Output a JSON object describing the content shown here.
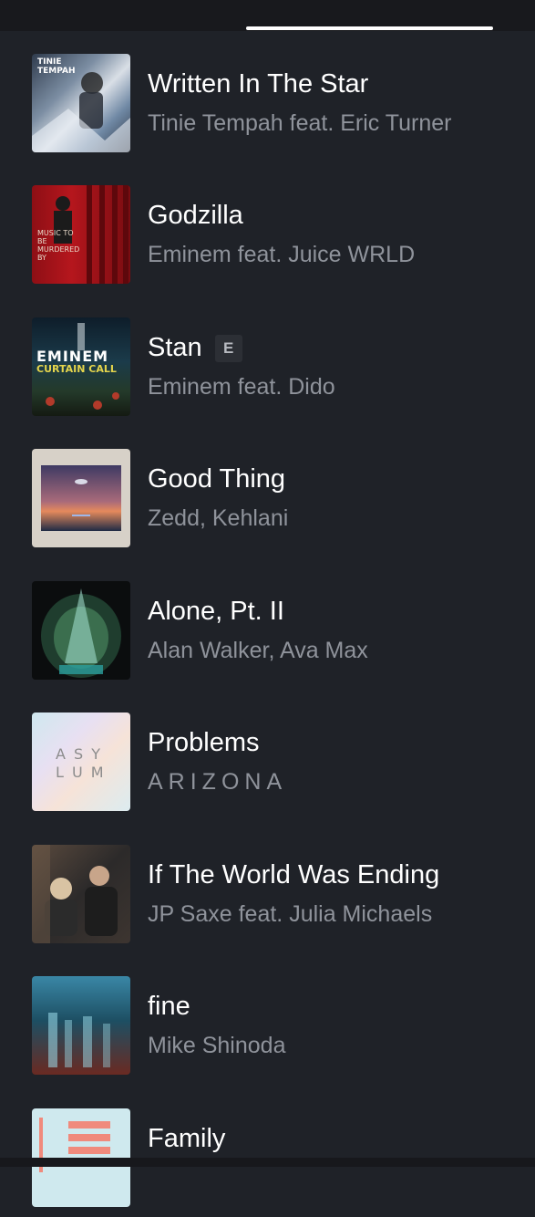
{
  "tracks": [
    {
      "title": "Written In The Star",
      "artist": "Tinie Tempah feat. Eric Turner",
      "explicit": false,
      "art_text": "TINIE TEMPAH"
    },
    {
      "title": "Godzilla",
      "artist": "Eminem feat. Juice WRLD",
      "explicit": false,
      "art_text": "MUSIC TO BE MURDERED BY"
    },
    {
      "title": "Stan",
      "artist": "Eminem feat. Dido",
      "explicit": true,
      "explicit_label": "E",
      "art_text_1": "EMINEM",
      "art_text_2": "CURTAIN CALL"
    },
    {
      "title": "Good Thing",
      "artist": "Zedd, Kehlani",
      "explicit": false
    },
    {
      "title": "Alone, Pt. II",
      "artist": "Alan Walker, Ava Max",
      "explicit": false
    },
    {
      "title": "Problems",
      "artist": "ARIZONA",
      "explicit": false,
      "art_text_1": "A S Y",
      "art_text_2": "L U M"
    },
    {
      "title": "If The World Was Ending",
      "artist": "JP Saxe feat. Julia Michaels",
      "explicit": false
    },
    {
      "title": "fine",
      "artist": "Mike Shinoda",
      "explicit": false
    },
    {
      "title": "Family",
      "artist": "",
      "explicit": false
    }
  ],
  "colors": {
    "background": "#1f2228",
    "title": "#ffffff",
    "subtitle": "#8f939b",
    "tab_indicator": "#ffffff"
  }
}
